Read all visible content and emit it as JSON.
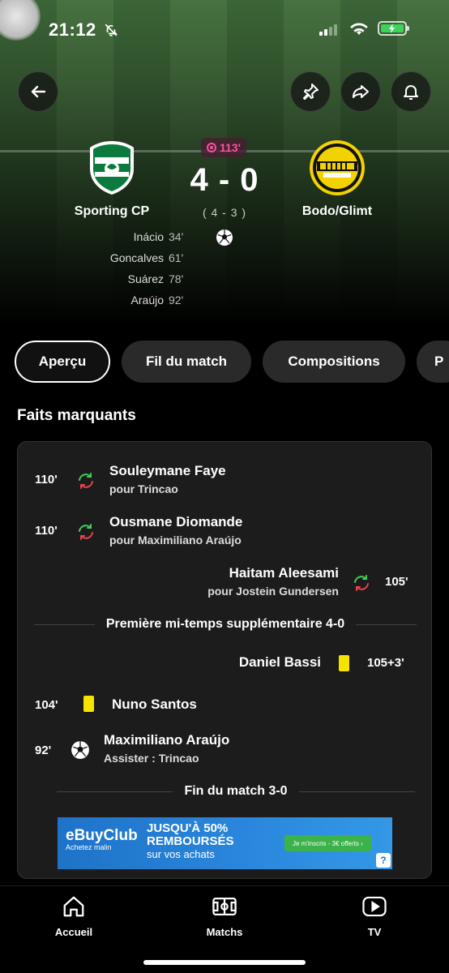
{
  "status_bar": {
    "time": "21:12"
  },
  "match": {
    "home": {
      "name": "Sporting CP"
    },
    "away": {
      "name": "Bodo/Glimt"
    },
    "minute": "113'",
    "score": "4 - 0",
    "penalties": "( 4 - 3 )",
    "home_scorers": [
      {
        "name": "Inácio",
        "minute": "34'"
      },
      {
        "name": "Goncalves",
        "minute": "61'"
      },
      {
        "name": "Suárez",
        "minute": "78'"
      },
      {
        "name": "Araújo",
        "minute": "92'"
      }
    ]
  },
  "tabs": [
    "Aperçu",
    "Fil du match",
    "Compositions",
    "P"
  ],
  "section_title": "Faits marquants",
  "events": {
    "e1": {
      "minute": "110'",
      "player": "Souleymane Faye",
      "detail": "pour Trincao"
    },
    "e2": {
      "minute": "110'",
      "player": "Ousmane Diomande",
      "detail": "pour Maximiliano Araújo"
    },
    "e3": {
      "minute": "105'",
      "player": "Haitam Aleesami",
      "detail": "pour Jostein Gundersen"
    },
    "d1": "Première mi-temps supplémentaire 4-0",
    "e4": {
      "minute": "105+3'",
      "player": "Daniel Bassi"
    },
    "e5": {
      "minute": "104'",
      "player": "Nuno Santos"
    },
    "e6": {
      "minute": "92'",
      "player": "Maximiliano Araújo",
      "detail": "Assister : Trincao"
    },
    "d2": "Fin du match 3-0"
  },
  "ad": {
    "brand": "eBuyClub",
    "brand_sub": "Achetez malin",
    "line1": "JUSQU'À 50%",
    "line2": "REMBOURSÉS",
    "line3": "sur vos achats",
    "cta": "Je m'inscris - 3€ offerts  ›",
    "help": "?"
  },
  "nav": {
    "home": "Accueil",
    "matches": "Matchs",
    "tv": "TV"
  },
  "colors": {
    "live": "#ff4fa0",
    "yellow_card": "#f5e400",
    "sub_in": "#3ecf5a",
    "sub_out": "#e8434b"
  }
}
